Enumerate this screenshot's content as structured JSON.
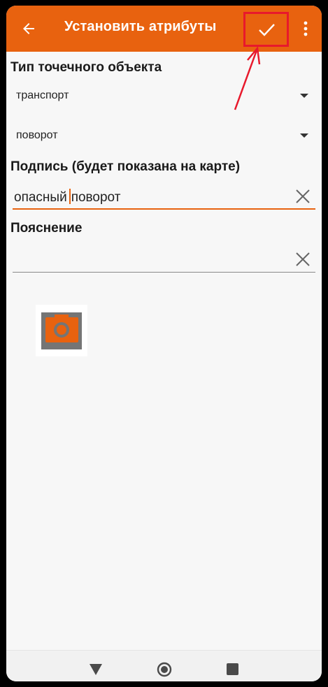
{
  "appbar": {
    "title": "Установить атрибуты",
    "back_icon": "arrow-left-icon",
    "confirm_icon": "check-icon",
    "menu_icon": "more-vert-icon",
    "bg_color": "#e8620f"
  },
  "form": {
    "type_label": "Тип точечного объекта",
    "category_value": "транспорт",
    "subtype_value": "поворот",
    "caption_label": "Подпись (будет показана на карте)",
    "caption_before_cursor": "опасный",
    "caption_after_cursor": "поворот",
    "note_label": "Пояснение",
    "note_value": ""
  },
  "photo": {
    "icon": "camera-icon"
  },
  "navbar": {
    "icons": [
      "back-triangle-icon",
      "home-circle-icon",
      "recents-square-icon"
    ]
  },
  "annotation": {
    "highlight_color": "#e8192c"
  }
}
